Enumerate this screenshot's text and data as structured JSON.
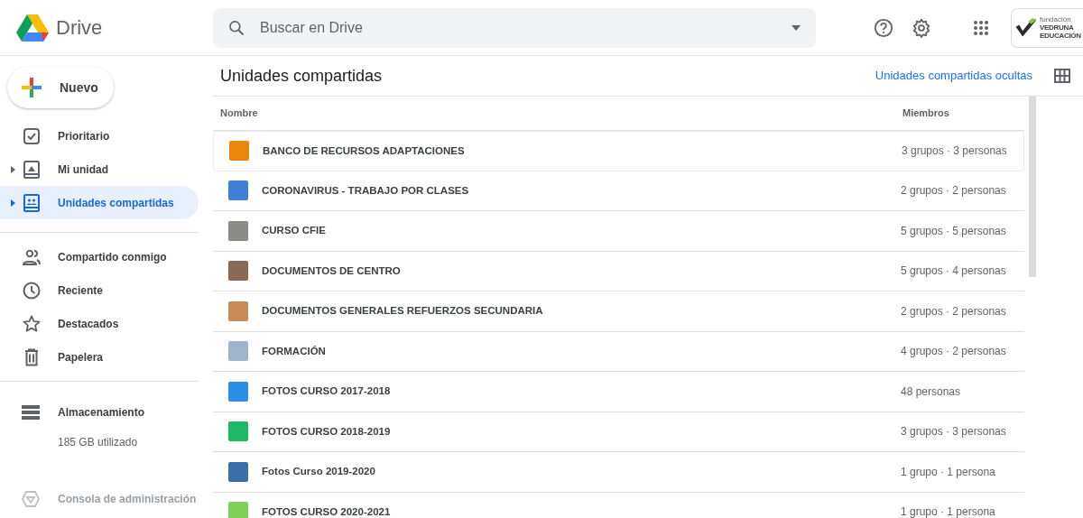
{
  "header": {
    "app_name": "Drive",
    "search": {
      "placeholder": "Buscar en Drive"
    },
    "org_logo": {
      "lines": [
        "fundación",
        "VEDRUNA",
        "EDUCACIÓN"
      ]
    }
  },
  "sidebar": {
    "new_button": "Nuevo",
    "groups": [
      [
        {
          "label": "Prioritario",
          "kind": "check",
          "expandable": false,
          "selected": false
        },
        {
          "label": "Mi unidad",
          "kind": "drive",
          "expandable": true,
          "selected": false
        },
        {
          "label": "Unidades compartidas",
          "kind": "shared",
          "expandable": true,
          "selected": true
        }
      ],
      [
        {
          "label": "Compartido conmigo",
          "kind": "people",
          "expandable": false,
          "selected": false
        },
        {
          "label": "Reciente",
          "kind": "clock",
          "expandable": false,
          "selected": false
        },
        {
          "label": "Destacados",
          "kind": "star",
          "expandable": false,
          "selected": false
        },
        {
          "label": "Papelera",
          "kind": "trash",
          "expandable": false,
          "selected": false
        }
      ]
    ],
    "storage": {
      "label": "Almacenamiento",
      "used": "185 GB utilizado"
    },
    "admin_console": "Consola de administración"
  },
  "main": {
    "title": "Unidades compartidas",
    "hidden_link": "Unidades compartidas ocultas",
    "table": {
      "columns": [
        "Nombre",
        "Miembros"
      ],
      "rows": [
        {
          "name": "BANCO DE RECURSOS ADAPTACIONES",
          "members": "3 grupos · 3 personas",
          "color": "#e8870c",
          "selected": true
        },
        {
          "name": "CORONAVIRUS - TRABAJO POR CLASES",
          "members": "2 grupos · 2 personas",
          "color": "#3f7fd6",
          "selected": false
        },
        {
          "name": "CURSO CFIE",
          "members": "5 grupos · 5 personas",
          "color": "#8a8a86",
          "selected": false
        },
        {
          "name": "DOCUMENTOS DE CENTRO",
          "members": "5 grupos · 4 personas",
          "color": "#8b6a55",
          "selected": false
        },
        {
          "name": "DOCUMENTOS GENERALES REFUERZOS SECUNDARIA",
          "members": "2 grupos · 2 personas",
          "color": "#c98a5a",
          "selected": false
        },
        {
          "name": "FORMACIÓN",
          "members": "4 grupos · 2 personas",
          "color": "#9fb4cc",
          "selected": false
        },
        {
          "name": "FOTOS CURSO 2017-2018",
          "members": "48 personas",
          "color": "#2a8ee8",
          "selected": false
        },
        {
          "name": "FOTOS CURSO 2018-2019",
          "members": "3 grupos · 3 personas",
          "color": "#1fb865",
          "selected": false
        },
        {
          "name": "Fotos Curso 2019-2020",
          "members": "1 grupo · 1 persona",
          "color": "#3c6ea8",
          "selected": false
        },
        {
          "name": "FOTOS CURSO 2020-2021",
          "members": "1 grupo · 1 persona",
          "color": "#7fcf5a",
          "selected": false
        }
      ]
    }
  }
}
